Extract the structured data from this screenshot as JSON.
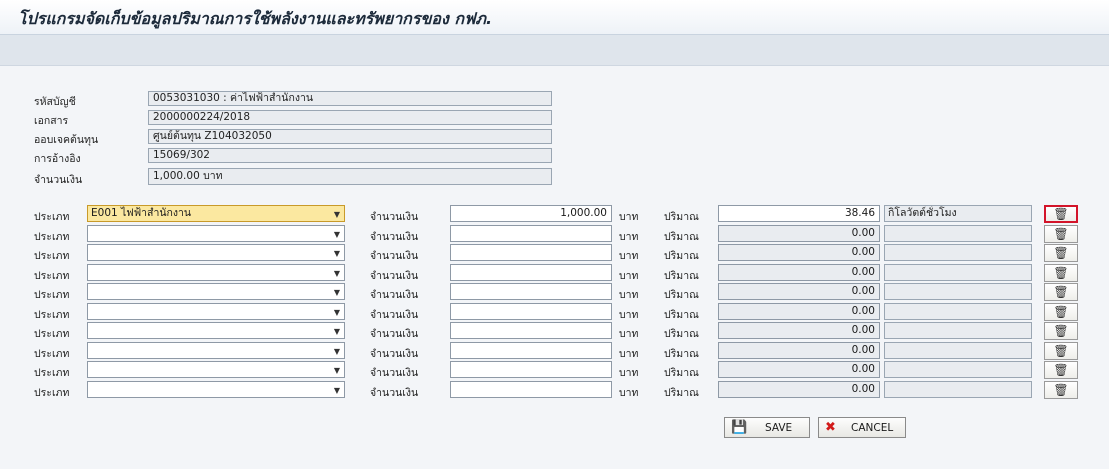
{
  "title": "โปรแกรมจัดเก็บข้อมูลปริมาณการใช้พลังงานและทรัพยากรของ กฟภ.",
  "header": {
    "account_label": "รหัสบัญชี",
    "account_value": "0053031030 : ค่าไฟฟ้าสำนักงาน",
    "doc_label": "เอกสาร",
    "doc_value": "2000000224/2018",
    "cost_label": "ออบเจคต้นทุน",
    "cost_value": "ศูนย์ต้นทุน Z104032050",
    "ref_label": "การอ้างอิง",
    "ref_value": "15069/302",
    "amount_label": "จำนวนเงิน",
    "amount_value": "1,000.00 บาท"
  },
  "labels": {
    "type": "ประเภท",
    "amount": "จำนวนเงิน",
    "baht": "บาท",
    "quantity": "ปริมาณ"
  },
  "icons": {
    "dropdown": "chevron-down-icon",
    "delete": "trash-icon"
  },
  "rows": [
    {
      "type": "E001 ไฟฟ้าสำนักงาน",
      "amount": "1,000.00",
      "quantity": "38.46",
      "unit": "กิโลวัตต์ชั่วโมง"
    },
    {
      "type": "",
      "amount": "",
      "quantity": "0.00",
      "unit": ""
    },
    {
      "type": "",
      "amount": "",
      "quantity": "0.00",
      "unit": ""
    },
    {
      "type": "",
      "amount": "",
      "quantity": "0.00",
      "unit": ""
    },
    {
      "type": "",
      "amount": "",
      "quantity": "0.00",
      "unit": ""
    },
    {
      "type": "",
      "amount": "",
      "quantity": "0.00",
      "unit": ""
    },
    {
      "type": "",
      "amount": "",
      "quantity": "0.00",
      "unit": ""
    },
    {
      "type": "",
      "amount": "",
      "quantity": "0.00",
      "unit": ""
    },
    {
      "type": "",
      "amount": "",
      "quantity": "0.00",
      "unit": ""
    },
    {
      "type": "",
      "amount": "",
      "quantity": "0.00",
      "unit": ""
    }
  ],
  "buttons": {
    "save": "SAVE",
    "cancel": "CANCEL"
  },
  "colors": {
    "active_field": "#fbe8a0",
    "delete_highlight": "#d3142a"
  }
}
